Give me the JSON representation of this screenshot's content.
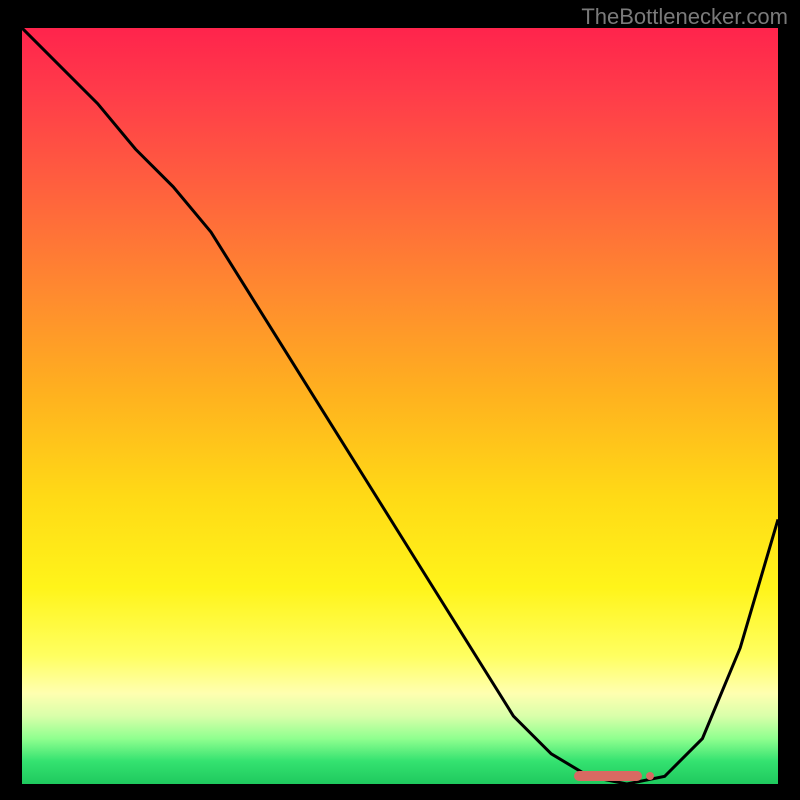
{
  "watermark": "TheBottlenecker.com",
  "chart_data": {
    "type": "line",
    "title": "",
    "xlabel": "",
    "ylabel": "",
    "xlim": [
      0,
      100
    ],
    "ylim": [
      0,
      100
    ],
    "x": [
      0,
      5,
      10,
      15,
      20,
      25,
      30,
      35,
      40,
      45,
      50,
      55,
      60,
      65,
      70,
      75,
      80,
      85,
      90,
      95,
      100
    ],
    "values": [
      100,
      95,
      90,
      84,
      79,
      73,
      65,
      57,
      49,
      41,
      33,
      25,
      17,
      9,
      4,
      1,
      0,
      1,
      6,
      18,
      35
    ],
    "optimum_range": [
      73,
      82
    ]
  }
}
